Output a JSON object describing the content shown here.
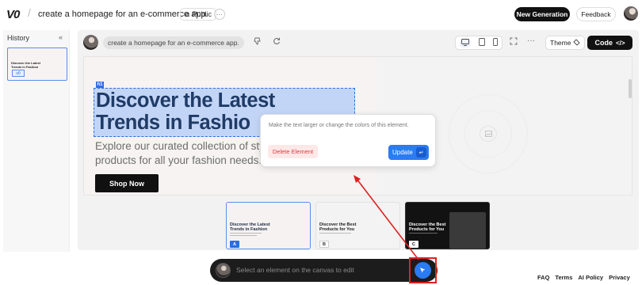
{
  "app": {
    "logo": "V0",
    "project_title": "create a homepage for an e-commerce app.",
    "visibility": "Public",
    "more": "···"
  },
  "header": {
    "new_generation": "New Generation",
    "feedback": "Feedback"
  },
  "history": {
    "title": "History",
    "collapse": "«",
    "items": [
      {
        "thumb_title": "Discover the Latest\nTrends in Fashion",
        "version": "v0"
      }
    ]
  },
  "toolbar": {
    "prompt": "create a homepage for an e-commerce app.",
    "dislike_icon": "thumbs-down-icon",
    "regenerate_icon": "refresh-icon",
    "theme": "Theme",
    "code": "Code",
    "code_icon": "</>"
  },
  "preview": {
    "element_tag": "h1",
    "headline": "Discover the Latest\nTrends in Fashio",
    "subtext": "Explore our curated collection of styl\nproducts for all your fashion needs.",
    "cta": "Shop Now"
  },
  "popover": {
    "prompt": "Make the text larger or change the colors of this element.",
    "delete": "Delete Element",
    "update": "Update",
    "enter_icon": "↵"
  },
  "variants": [
    {
      "title": "Discover the Latest\nTrends in Fashion",
      "badge": "A"
    },
    {
      "title": "Discover the Best\nProducts for You",
      "badge": "B"
    },
    {
      "title": "Discover the Best\nProducts for You",
      "badge": "C"
    }
  ],
  "bottom_bar": {
    "placeholder": "Select an element on the canvas to edit"
  },
  "footer": {
    "links": [
      "FAQ",
      "Terms",
      "AI Policy",
      "Privacy"
    ]
  },
  "colors": {
    "accent_blue": "#2b7bf2",
    "highlight_red": "#e02020",
    "dark": "#111111",
    "headline": "#1f3b66"
  }
}
